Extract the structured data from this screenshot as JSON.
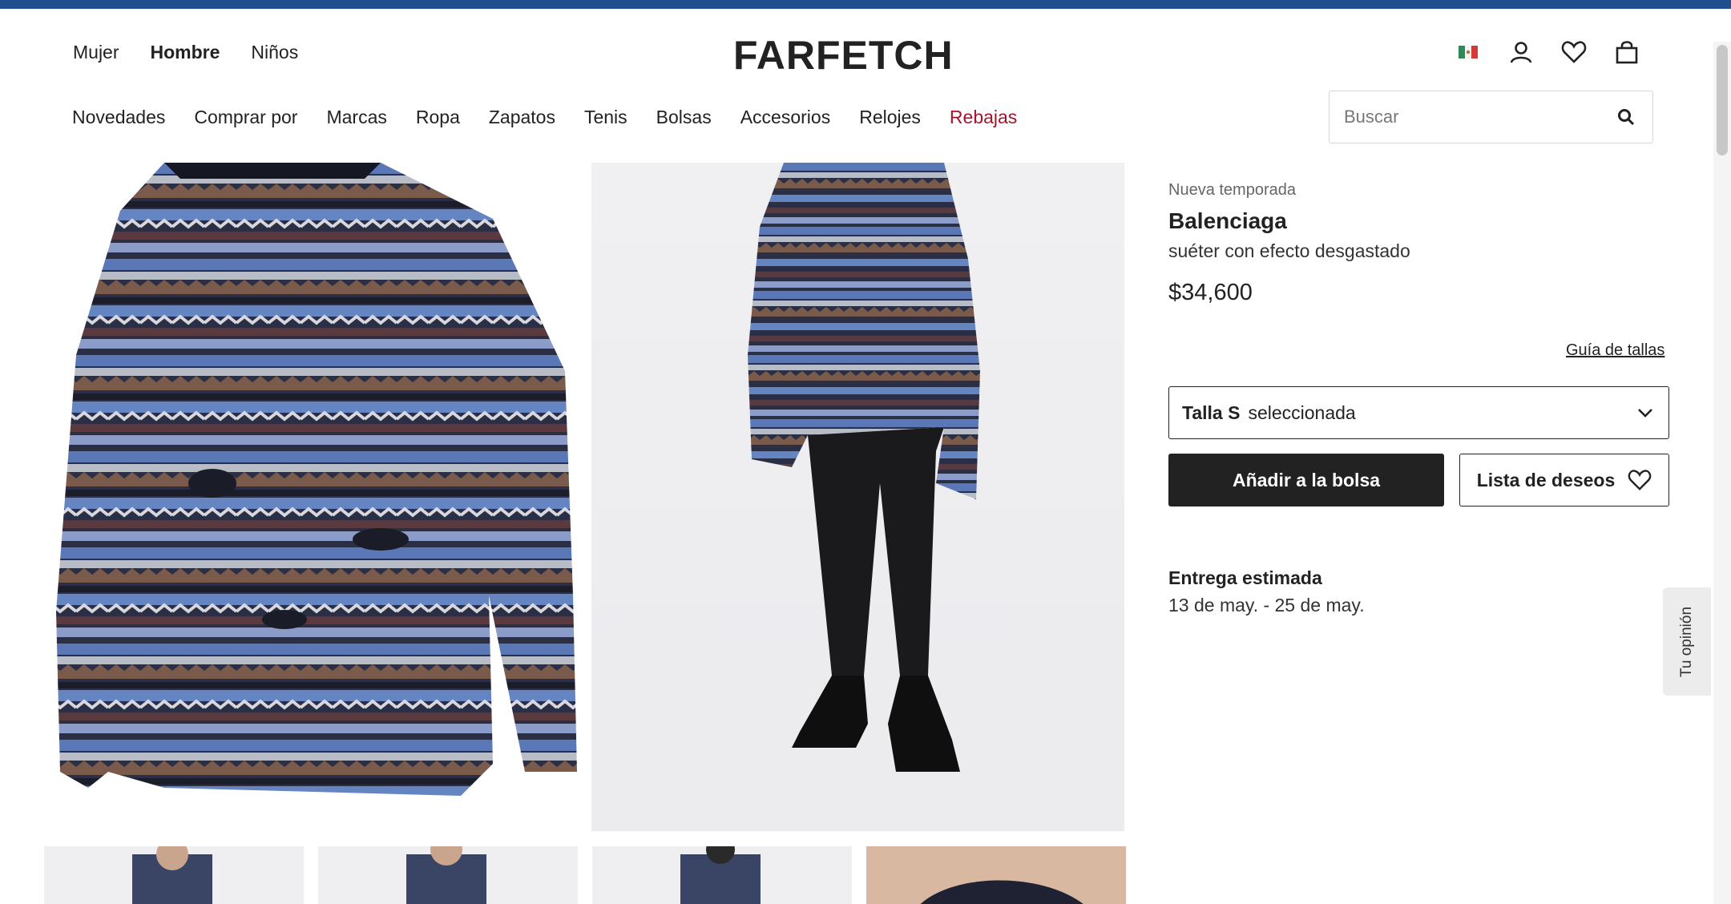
{
  "brand_logo": "FARFETCH",
  "gender_nav": [
    {
      "label": "Mujer",
      "active": false
    },
    {
      "label": "Hombre",
      "active": true
    },
    {
      "label": "Niños",
      "active": false
    }
  ],
  "header_icons": [
    "mexico-flag-icon",
    "account-icon",
    "wishlist-heart-icon",
    "shopping-bag-icon"
  ],
  "category_nav": [
    {
      "label": "Novedades"
    },
    {
      "label": "Comprar por"
    },
    {
      "label": "Marcas"
    },
    {
      "label": "Ropa"
    },
    {
      "label": "Zapatos"
    },
    {
      "label": "Tenis"
    },
    {
      "label": "Bolsas"
    },
    {
      "label": "Accesorios"
    },
    {
      "label": "Relojes"
    },
    {
      "label": "Rebajas"
    }
  ],
  "search": {
    "placeholder": "Buscar"
  },
  "product": {
    "season": "Nueva temporada",
    "brand": "Balenciaga",
    "name": "suéter con efecto desgastado",
    "price": "$34,600",
    "size_guide": "Guía de tallas",
    "size_label": "Talla S",
    "size_state": "seleccionada",
    "add_to_bag": "Añadir a la bolsa",
    "wishlist": "Lista de deseos"
  },
  "delivery": {
    "title": "Entrega estimada",
    "dates": "13 de may. - 25 de may."
  },
  "feedback_tab": "Tu opinión",
  "colors": {
    "top_bar": "#1f4f8f",
    "sale": "#a3152d",
    "button_dark": "#222222"
  }
}
